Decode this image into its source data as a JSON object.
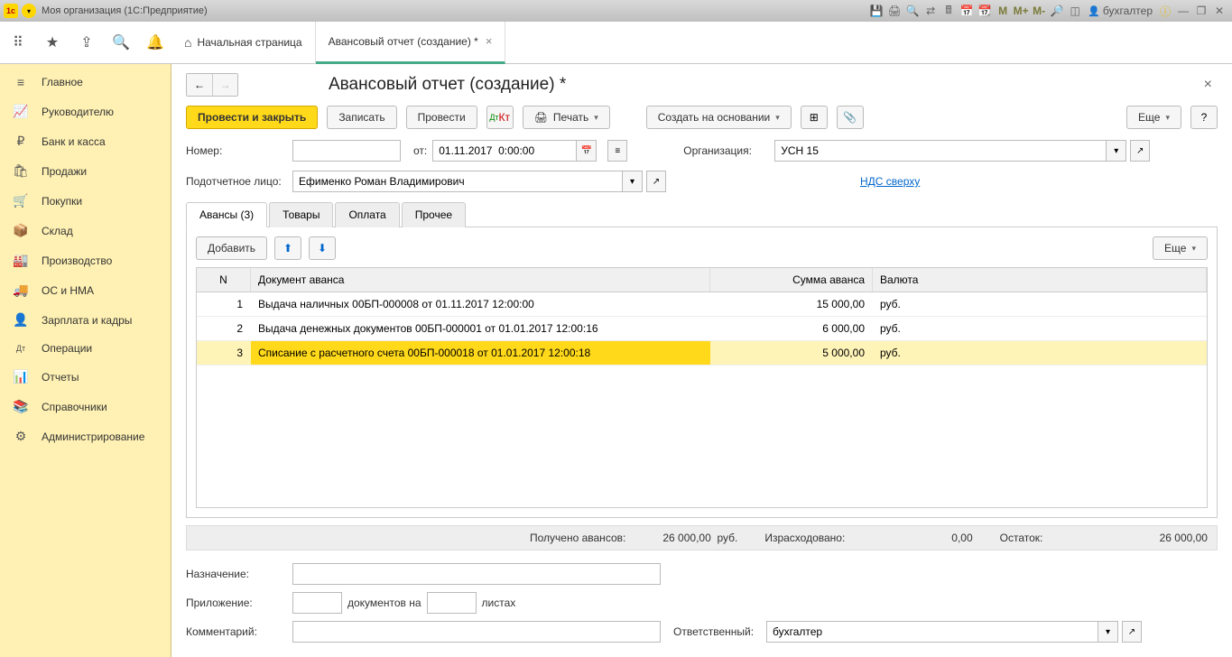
{
  "titlebar": {
    "title": "Моя организация  (1С:Предприятие)",
    "user": "бухгалтер",
    "m1": "M",
    "m2": "M+",
    "m3": "M-"
  },
  "tabs": {
    "home": "Начальная страница",
    "doc": "Авансовый отчет (создание) *"
  },
  "sidebar": {
    "items": [
      {
        "label": "Главное",
        "icon": "≡"
      },
      {
        "label": "Руководителю",
        "icon": "📈"
      },
      {
        "label": "Банк и касса",
        "icon": "₽"
      },
      {
        "label": "Продажи",
        "icon": "🛍"
      },
      {
        "label": "Покупки",
        "icon": "🛒"
      },
      {
        "label": "Склад",
        "icon": "📦"
      },
      {
        "label": "Производство",
        "icon": "🏭"
      },
      {
        "label": "ОС и НМА",
        "icon": "🚚"
      },
      {
        "label": "Зарплата и кадры",
        "icon": "👤"
      },
      {
        "label": "Операции",
        "icon": "Дт"
      },
      {
        "label": "Отчеты",
        "icon": "📊"
      },
      {
        "label": "Справочники",
        "icon": "📚"
      },
      {
        "label": "Администрирование",
        "icon": "⚙"
      }
    ]
  },
  "page": {
    "title": "Авансовый отчет (создание) *"
  },
  "toolbar": {
    "post_close": "Провести и закрыть",
    "save": "Записать",
    "post": "Провести",
    "print": "Печать",
    "create_based": "Создать на основании",
    "more": "Еще"
  },
  "form": {
    "number_label": "Номер:",
    "number_value": "",
    "from_label": "от:",
    "date_value": "01.11.2017  0:00:00",
    "org_label": "Организация:",
    "org_value": "УСН 15",
    "person_label": "Подотчетное лицо:",
    "person_value": "Ефименко Роман Владимирович",
    "nds_link": "НДС сверху"
  },
  "innertabs": {
    "t1": "Авансы (3)",
    "t2": "Товары",
    "t3": "Оплата",
    "t4": "Прочее"
  },
  "tablebar": {
    "add": "Добавить",
    "more": "Еще"
  },
  "grid": {
    "head": {
      "n": "N",
      "doc": "Документ аванса",
      "sum": "Сумма аванса",
      "cur": "Валюта"
    },
    "rows": [
      {
        "n": "1",
        "doc": "Выдача наличных 00БП-000008 от 01.11.2017 12:00:00",
        "sum": "15 000,00",
        "cur": "руб."
      },
      {
        "n": "2",
        "doc": "Выдача денежных документов 00БП-000001 от 01.01.2017 12:00:16",
        "sum": "6 000,00",
        "cur": "руб."
      },
      {
        "n": "3",
        "doc": "Списание с расчетного счета 00БП-000018 от 01.01.2017 12:00:18",
        "sum": "5 000,00",
        "cur": "руб."
      }
    ]
  },
  "totals": {
    "received_label": "Получено авансов:",
    "received_value": "26 000,00",
    "received_cur": "руб.",
    "spent_label": "Израсходовано:",
    "spent_value": "0,00",
    "rest_label": "Остаток:",
    "rest_value": "26 000,00"
  },
  "bottom": {
    "purpose_label": "Назначение:",
    "attach_label": "Приложение:",
    "attach_docs": "документов на",
    "attach_sheets": "листах",
    "comment_label": "Комментарий:",
    "resp_label": "Ответственный:",
    "resp_value": "бухгалтер"
  },
  "help": "?"
}
